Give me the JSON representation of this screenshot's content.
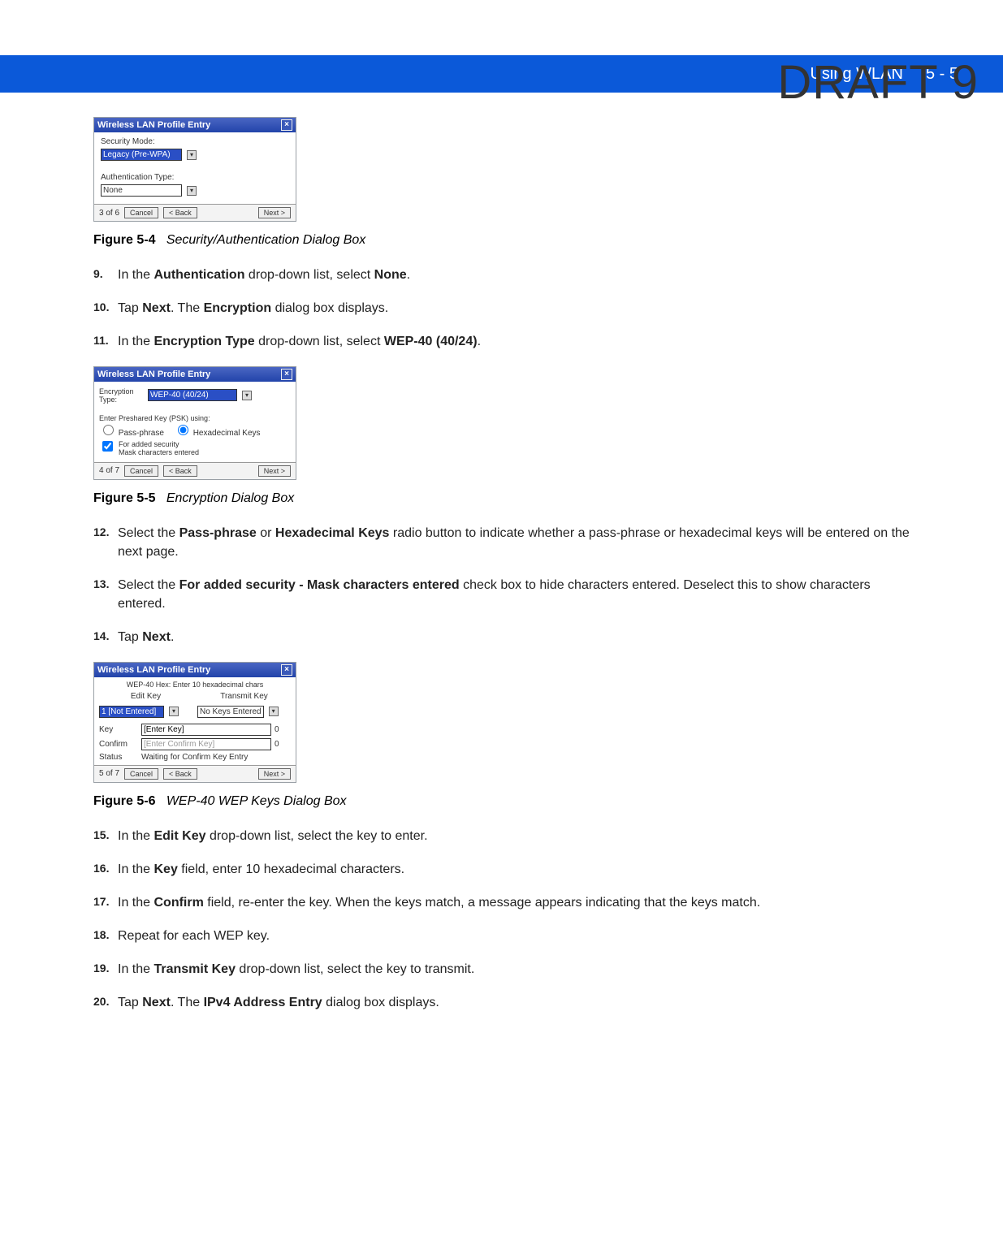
{
  "draft_label": "DRAFT 9",
  "header": {
    "section": "Using WLAN",
    "page": "5 - 5"
  },
  "dialog1": {
    "title": "Wireless LAN Profile Entry",
    "sec_mode_label": "Security Mode:",
    "sec_mode_value": "Legacy (Pre-WPA)",
    "auth_type_label": "Authentication Type:",
    "auth_type_value": "None",
    "step": "3 of 6",
    "cancel": "Cancel",
    "back": "< Back",
    "next": "Next >"
  },
  "fig4": {
    "label": "Figure 5-4",
    "caption": "Security/Authentication Dialog Box"
  },
  "step9_num": "9.",
  "step9_1": "In the ",
  "step9_b1": "Authentication",
  "step9_2": " drop-down list, select ",
  "step9_b2": "None",
  "step9_3": ".",
  "step10_num": "10.",
  "step10_1": "Tap ",
  "step10_b1": "Next",
  "step10_2": ". The ",
  "step10_b2": "Encryption",
  "step10_3": " dialog box displays.",
  "step11_num": "11.",
  "step11_1": "In the ",
  "step11_b1": "Encryption Type",
  "step11_2": " drop-down list, select ",
  "step11_b2": "WEP-40 (40/24)",
  "step11_3": ".",
  "dialog2": {
    "title": "Wireless LAN Profile Entry",
    "enc_label": "Encryption Type:",
    "enc_value": "WEP-40 (40/24)",
    "psk_label": "Enter Preshared Key (PSK) using:",
    "radio1": "Pass-phrase",
    "radio2": "Hexadecimal Keys",
    "check_label1": "For added security",
    "check_label2": "Mask characters entered",
    "step": "4 of 7",
    "cancel": "Cancel",
    "back": "< Back",
    "next": "Next >"
  },
  "fig5": {
    "label": "Figure 5-5",
    "caption": "Encryption Dialog Box"
  },
  "step12_num": "12.",
  "step12_1": "Select the ",
  "step12_b1": "Pass-phrase",
  "step12_2": " or ",
  "step12_b2": "Hexadecimal Keys",
  "step12_3": " radio button to indicate whether a pass-phrase or hexadecimal keys will be entered on the next page.",
  "step13_num": "13.",
  "step13_1": "Select the ",
  "step13_b1": "For added security - Mask characters entered",
  "step13_2": " check box to hide characters entered. Deselect this to show characters entered.",
  "step14_num": "14.",
  "step14_1": "Tap ",
  "step14_b1": "Next",
  "step14_2": ".",
  "dialog3": {
    "title": "Wireless LAN Profile Entry",
    "hint": "WEP-40 Hex: Enter 10 hexadecimal chars",
    "editkey_h": "Edit Key",
    "transmitkey_h": "Transmit Key",
    "editkey_val": "1 [Not Entered]",
    "transmitkey_val": "No Keys Entered",
    "key_label": "Key",
    "key_value": "[Enter Key]",
    "key_count": "0",
    "confirm_label": "Confirm",
    "confirm_value": "[Enter Confirm Key]",
    "confirm_count": "0",
    "status_label": "Status",
    "status_value": "Waiting for Confirm Key Entry",
    "step": "5 of 7",
    "cancel": "Cancel",
    "back": "< Back",
    "next": "Next >"
  },
  "fig6": {
    "label": "Figure 5-6",
    "caption": "WEP-40 WEP Keys Dialog Box"
  },
  "step15_num": "15.",
  "step15_1": "In the ",
  "step15_b1": "Edit Key",
  "step15_2": " drop-down list, select the key to enter.",
  "step16_num": "16.",
  "step16_1": "In the ",
  "step16_b1": "Key",
  "step16_2": " field, enter 10 hexadecimal characters.",
  "step17_num": "17.",
  "step17_1": "In the ",
  "step17_b1": "Confirm",
  "step17_2": " field, re-enter the key. When the keys match, a message appears indicating that the keys match.",
  "step18_num": "18.",
  "step18_txt": "Repeat for each WEP key.",
  "step19_num": "19.",
  "step19_1": "In the ",
  "step19_b1": "Transmit Key",
  "step19_2": " drop-down list, select the key to transmit.",
  "step20_num": "20.",
  "step20_1": "Tap ",
  "step20_b1": "Next",
  "step20_2": ". The ",
  "step20_b2": "IPv4 Address Entry",
  "step20_3": " dialog box displays."
}
